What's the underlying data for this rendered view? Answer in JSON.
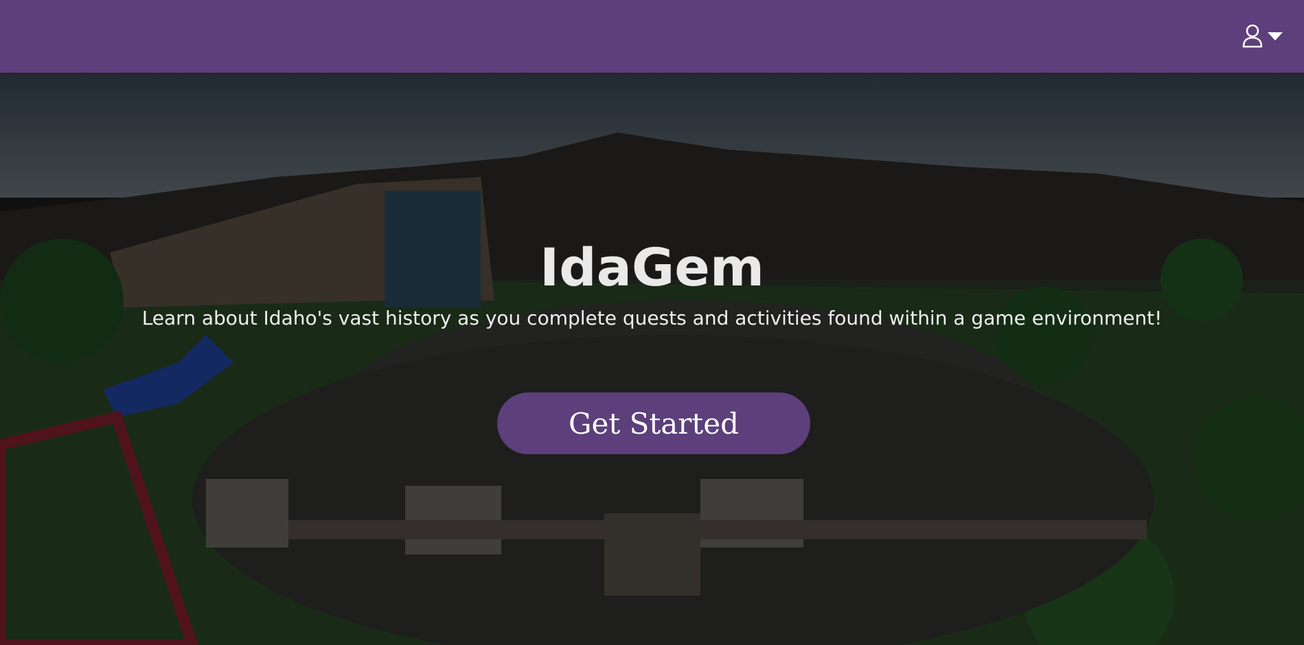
{
  "colors": {
    "brand": "#5c3f7b",
    "title": "#e9e9e9",
    "cta_text": "#ffffff"
  },
  "header": {
    "user_menu": {
      "icon": "user-icon",
      "caret": "caret-down-icon"
    }
  },
  "hero": {
    "title": "IdaGem",
    "subtitle": "Learn about Idaho's vast history as you complete quests and activities found within a game environment!",
    "cta_label": "Get Started"
  }
}
